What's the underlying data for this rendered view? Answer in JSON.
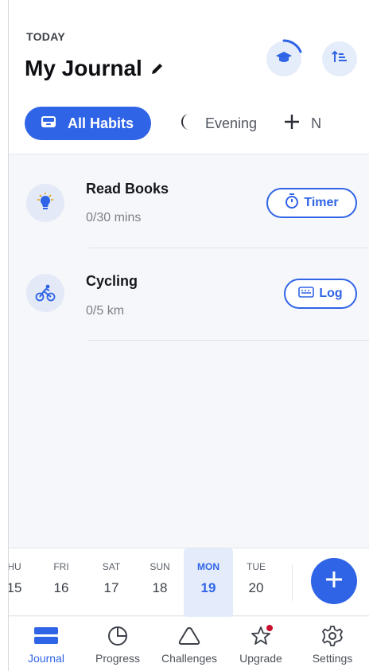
{
  "header": {
    "overline": "TODAY",
    "title": "My Journal",
    "icons": [
      "graduation-cap-icon",
      "sort-icon",
      "pencil-icon"
    ]
  },
  "tabs": [
    {
      "label": "All Habits",
      "icon": "tray-icon",
      "active": true
    },
    {
      "label": "Evening",
      "icon": "moon-icon",
      "active": false
    },
    {
      "label": "N",
      "icon": "plus-icon",
      "active": false
    }
  ],
  "habits": [
    {
      "name": "Read Books",
      "progress": "0/30 mins",
      "icon": "lightbulb-icon",
      "action": "Timer",
      "action_icon": "stopwatch-icon"
    },
    {
      "name": "Cycling",
      "progress": "0/5 km",
      "icon": "cyclist-icon",
      "action": "Log",
      "action_icon": "keyboard-icon"
    }
  ],
  "week": {
    "days": [
      {
        "name": "HU",
        "date": "15"
      },
      {
        "name": "FRI",
        "date": "16"
      },
      {
        "name": "SAT",
        "date": "17"
      },
      {
        "name": "SUN",
        "date": "18"
      },
      {
        "name": "MON",
        "date": "19",
        "selected": true
      },
      {
        "name": "TUE",
        "date": "20"
      }
    ]
  },
  "nav": [
    {
      "label": "Journal",
      "icon": "journal-icon",
      "active": true
    },
    {
      "label": "Progress",
      "icon": "pie-chart-icon"
    },
    {
      "label": "Challenges",
      "icon": "mountain-icon"
    },
    {
      "label": "Upgrade",
      "icon": "star-icon",
      "badge": true
    },
    {
      "label": "Settings",
      "icon": "gear-icon"
    }
  ],
  "colors": {
    "accent": "#2f64e6",
    "badge": "#c8102e",
    "icon_bg": "#e3e9f7"
  }
}
